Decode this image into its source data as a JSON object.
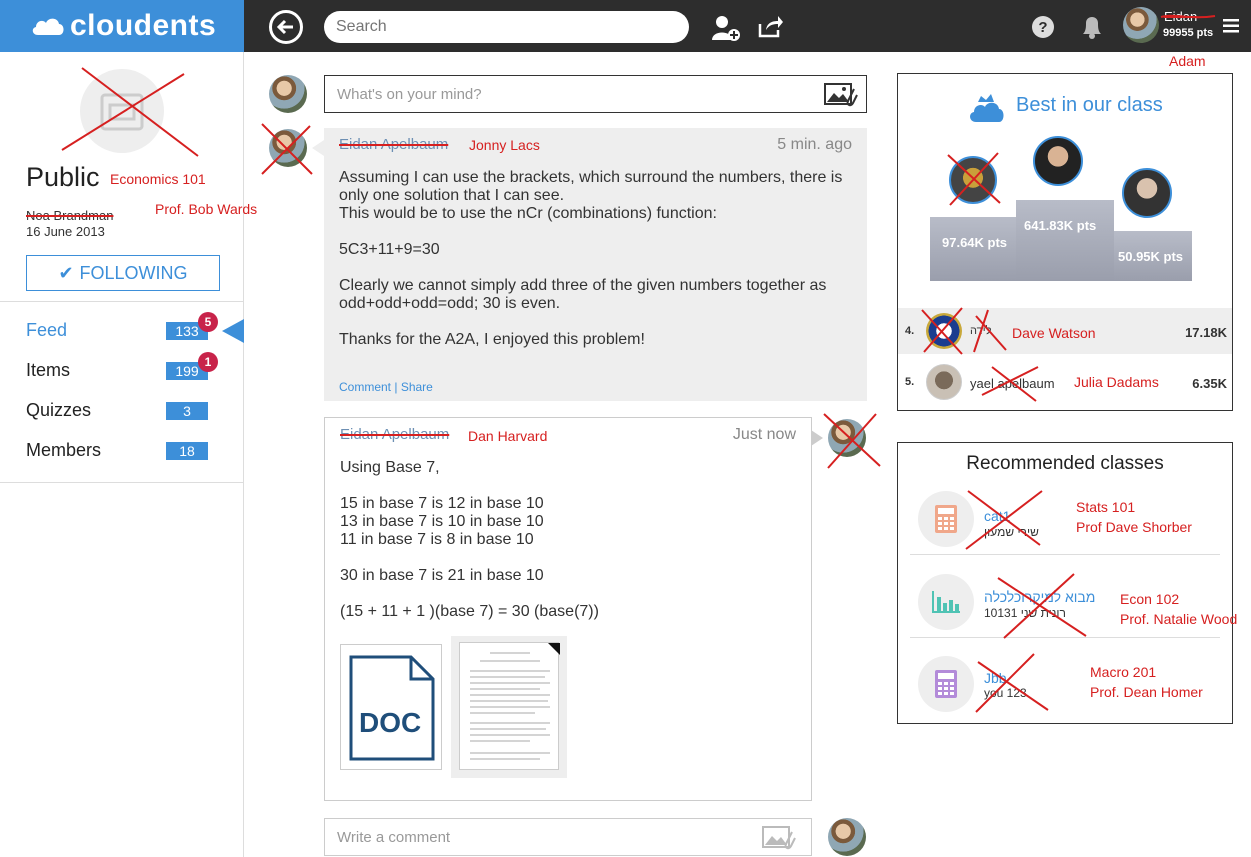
{
  "topbar": {
    "brand": "cloudents",
    "search_placeholder": "Search",
    "user_name": "Eidan",
    "user_points": "99955 pts",
    "annotation_user": "Adam"
  },
  "sidebar": {
    "class_type": "Public",
    "annotation_class": "Economics 101",
    "owner_name": "Noa Brandman",
    "annotation_owner": "Prof. Bob Wards",
    "created_date": "16 June 2013",
    "follow_label": "FOLLOWING",
    "nav": [
      {
        "label": "Feed",
        "count": "133",
        "badge": "5"
      },
      {
        "label": "Items",
        "count": "199",
        "badge": "1"
      },
      {
        "label": "Quizzes",
        "count": "3",
        "badge": ""
      },
      {
        "label": "Members",
        "count": "18",
        "badge": ""
      }
    ]
  },
  "feed": {
    "post_placeholder": "What's on your mind?",
    "post1": {
      "author": "Eidan Apelbaum",
      "annotation_author": "Jonny Lacs",
      "time": "5 min. ago",
      "body": "Assuming I can use the brackets, which surround the numbers, there is\nonly one solution that I can see.\nThis would be to use the nCr (combinations) function:\n\n5C3+11+9=30\n\nClearly we cannot simply add three of the given numbers together as\nodd+odd+odd=odd; 30 is even.\n\nThanks for the A2A, I enjoyed this problem!",
      "comment_link": "Comment",
      "share_link": "Share"
    },
    "post2": {
      "author": "Eidan Apelbaum",
      "annotation_author": "Dan Harvard",
      "time": "Just now",
      "body": "Using Base 7,\n\n15 in base 7 is 12 in base 10\n13 in base 7 is 10 in base 10\n11 in base 7 is 8 in base 10\n\n30 in base 7 is 21 in base 10\n\n(15 + 11 + 1 )(base 7) = 30 (base(7))",
      "doc_label": "DOC"
    },
    "comment_placeholder": "Write a comment"
  },
  "best": {
    "title": "Best in our class",
    "podium": [
      {
        "pts": "97.64K pts"
      },
      {
        "pts": "641.83K pts"
      },
      {
        "pts": "50.95K pts"
      }
    ],
    "leaderboard": [
      {
        "rank": "4.",
        "name": "לידה",
        "annotation": "Dave Watson",
        "score": "17.18K"
      },
      {
        "rank": "5.",
        "name": "yael apelbaum",
        "annotation": "Julia Dadams",
        "score": "6.35K"
      }
    ]
  },
  "recommended": {
    "title": "Recommended classes",
    "items": [
      {
        "name": "cat1",
        "sub": "שירי שמעון",
        "annotation1": "Stats 101",
        "annotation2": "Prof Dave Shorber"
      },
      {
        "name": "מבוא למיקרוכלכלה",
        "sub": "רונית שני 10131",
        "annotation1": "Econ 102",
        "annotation2": "Prof. Natalie Wood"
      },
      {
        "name": "Jbb",
        "sub": "you 123",
        "annotation1": "Macro 201",
        "annotation2": "Prof. Dean Homer"
      }
    ]
  },
  "colors": {
    "accent": "#3d8fd9",
    "annotation": "#d62020",
    "badge": "#c8234a"
  }
}
